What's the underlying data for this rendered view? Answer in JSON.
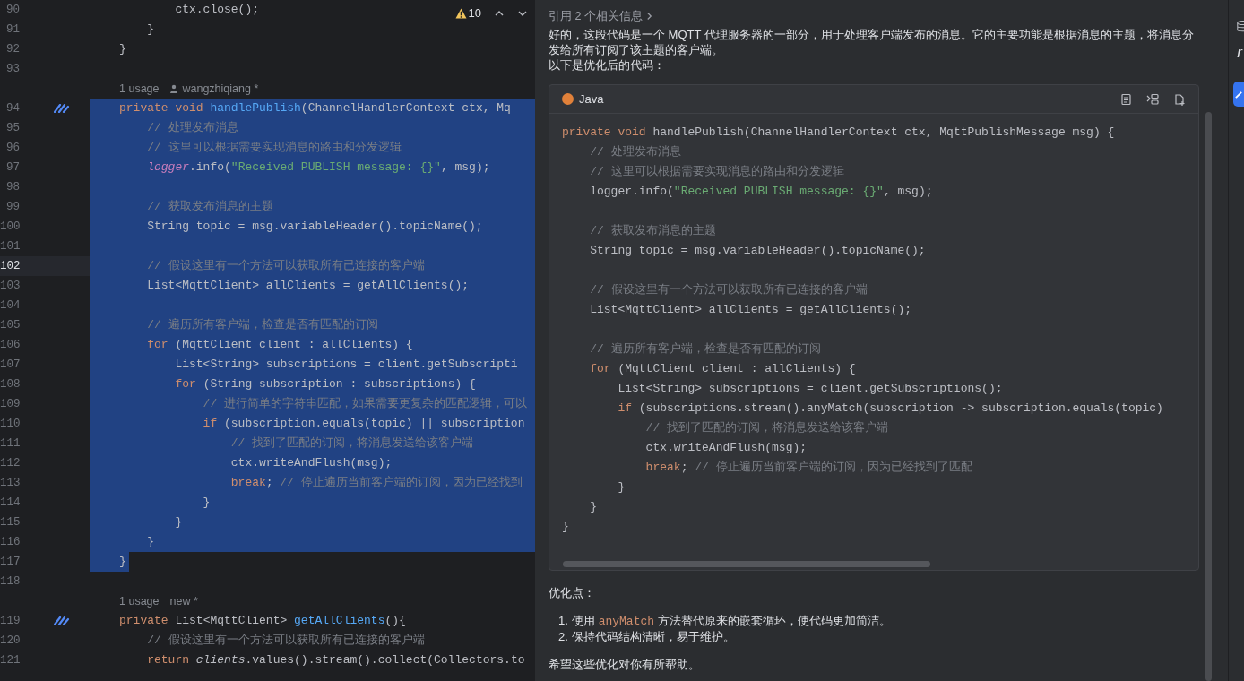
{
  "editor": {
    "inspection": {
      "warnings": "10"
    },
    "lines": [
      {
        "kind": "code",
        "number": "90",
        "selected": false,
        "current": false,
        "gutter_mark": false,
        "tokens": [
          {
            "kind": "plain",
            "text": "        ctx.close();"
          }
        ]
      },
      {
        "kind": "code",
        "number": "91",
        "selected": false,
        "current": false,
        "gutter_mark": false,
        "tokens": [
          {
            "kind": "plain",
            "text": "    }"
          }
        ]
      },
      {
        "kind": "code",
        "number": "92",
        "selected": false,
        "current": false,
        "gutter_mark": false,
        "tokens": [
          {
            "kind": "plain",
            "text": "}"
          }
        ]
      },
      {
        "kind": "blank",
        "number": "93",
        "selected": false,
        "current": false,
        "gutter_mark": false
      },
      {
        "kind": "annotation",
        "usage": "1 usage",
        "author": "wangzhiqiang *",
        "person_icon": true
      },
      {
        "kind": "code",
        "number": "94",
        "selected": true,
        "current": false,
        "gutter_mark": true,
        "tokens": [
          {
            "kind": "kw",
            "text": "private void "
          },
          {
            "kind": "fn",
            "text": "handlePublish"
          },
          {
            "kind": "plain",
            "text": "(ChannelHandlerContext ctx, Mq"
          }
        ]
      },
      {
        "kind": "code",
        "number": "95",
        "selected": true,
        "current": false,
        "gutter_mark": false,
        "tokens": [
          {
            "kind": "cmt",
            "text": "    // 处理发布消息"
          }
        ]
      },
      {
        "kind": "code",
        "number": "96",
        "selected": true,
        "current": false,
        "gutter_mark": false,
        "tokens": [
          {
            "kind": "cmt",
            "text": "    // 这里可以根据需要实现消息的路由和分发逻辑"
          }
        ]
      },
      {
        "kind": "code",
        "number": "97",
        "selected": true,
        "current": false,
        "gutter_mark": false,
        "tokens": [
          {
            "kind": "field",
            "text": "    logger"
          },
          {
            "kind": "plain",
            "text": ".info("
          },
          {
            "kind": "str",
            "text": "\"Received PUBLISH message: {}\""
          },
          {
            "kind": "plain",
            "text": ", msg);"
          }
        ]
      },
      {
        "kind": "blank",
        "number": "98",
        "selected": true,
        "current": false,
        "gutter_mark": false
      },
      {
        "kind": "code",
        "number": "99",
        "selected": true,
        "current": false,
        "gutter_mark": false,
        "tokens": [
          {
            "kind": "cmt",
            "text": "    // 获取发布消息的主题"
          }
        ]
      },
      {
        "kind": "code",
        "number": "100",
        "selected": true,
        "current": false,
        "gutter_mark": false,
        "tokens": [
          {
            "kind": "plain",
            "text": "    String topic = msg.variableHeader().topicName();"
          }
        ]
      },
      {
        "kind": "blank",
        "number": "101",
        "selected": true,
        "current": false,
        "gutter_mark": false
      },
      {
        "kind": "code",
        "number": "102",
        "selected": true,
        "current": true,
        "gutter_mark": false,
        "tokens": [
          {
            "kind": "cmt",
            "text": "    // 假设这里有一个方法可以获取所有已连接的客户端"
          }
        ]
      },
      {
        "kind": "code",
        "number": "103",
        "selected": true,
        "current": false,
        "gutter_mark": false,
        "tokens": [
          {
            "kind": "plain",
            "text": "    List<MqttClient> allClients = getAllClients();"
          }
        ]
      },
      {
        "kind": "blank",
        "number": "104",
        "selected": true,
        "current": false,
        "gutter_mark": false
      },
      {
        "kind": "code",
        "number": "105",
        "selected": true,
        "current": false,
        "gutter_mark": false,
        "tokens": [
          {
            "kind": "cmt",
            "text": "    // 遍历所有客户端，检查是否有匹配的订阅"
          }
        ]
      },
      {
        "kind": "code",
        "number": "106",
        "selected": true,
        "current": false,
        "gutter_mark": false,
        "tokens": [
          {
            "kind": "kw",
            "text": "    for"
          },
          {
            "kind": "plain",
            "text": " (MqttClient client : allClients) {"
          }
        ]
      },
      {
        "kind": "code",
        "number": "107",
        "selected": true,
        "current": false,
        "gutter_mark": false,
        "tokens": [
          {
            "kind": "plain",
            "text": "        List<String> subscriptions = client.getSubscripti"
          }
        ]
      },
      {
        "kind": "code",
        "number": "108",
        "selected": true,
        "current": false,
        "gutter_mark": false,
        "tokens": [
          {
            "kind": "kw",
            "text": "        for"
          },
          {
            "kind": "plain",
            "text": " (String subscription : subscriptions) {"
          }
        ]
      },
      {
        "kind": "code",
        "number": "109",
        "selected": true,
        "current": false,
        "gutter_mark": false,
        "tokens": [
          {
            "kind": "cmt",
            "text": "            // 进行简单的字符串匹配，如果需要更复杂的匹配逻辑，可以"
          }
        ]
      },
      {
        "kind": "code",
        "number": "110",
        "selected": true,
        "current": false,
        "gutter_mark": false,
        "tokens": [
          {
            "kind": "kw",
            "text": "            if"
          },
          {
            "kind": "plain",
            "text": " (subscription.equals(topic) || subscription"
          }
        ]
      },
      {
        "kind": "code",
        "number": "111",
        "selected": true,
        "current": false,
        "gutter_mark": false,
        "tokens": [
          {
            "kind": "cmt",
            "text": "                // 找到了匹配的订阅，将消息发送给该客户端"
          }
        ]
      },
      {
        "kind": "code",
        "number": "112",
        "selected": true,
        "current": false,
        "gutter_mark": false,
        "tokens": [
          {
            "kind": "plain",
            "text": "                ctx.writeAndFlush(msg);"
          }
        ]
      },
      {
        "kind": "code",
        "number": "113",
        "selected": true,
        "current": false,
        "gutter_mark": false,
        "tokens": [
          {
            "kind": "kw",
            "text": "                break"
          },
          {
            "kind": "plain",
            "text": ";"
          },
          {
            "kind": "cmt",
            "text": " // 停止遍历当前客户端的订阅，因为已经找到"
          }
        ]
      },
      {
        "kind": "code",
        "number": "114",
        "selected": true,
        "current": false,
        "gutter_mark": false,
        "tokens": [
          {
            "kind": "plain",
            "text": "            }"
          }
        ]
      },
      {
        "kind": "code",
        "number": "115",
        "selected": true,
        "current": false,
        "gutter_mark": false,
        "tokens": [
          {
            "kind": "plain",
            "text": "        }"
          }
        ]
      },
      {
        "kind": "code",
        "number": "116",
        "selected": true,
        "current": false,
        "gutter_mark": false,
        "tokens": [
          {
            "kind": "plain",
            "text": "    }"
          }
        ]
      },
      {
        "kind": "code",
        "number": "117",
        "selected": true,
        "current": false,
        "gutter_mark": false,
        "tokens": [
          {
            "kind": "plain",
            "text": "}"
          }
        ]
      },
      {
        "kind": "blank",
        "number": "118",
        "selected": false,
        "current": false,
        "gutter_mark": false
      },
      {
        "kind": "annotation",
        "usage": "1 usage",
        "author": "new *",
        "person_icon": false
      },
      {
        "kind": "code",
        "number": "119",
        "selected": false,
        "current": false,
        "gutter_mark": true,
        "tokens": [
          {
            "kind": "kw",
            "text": "private "
          },
          {
            "kind": "plain",
            "text": "List<MqttClient> "
          },
          {
            "kind": "fn",
            "text": "getAllClients"
          },
          {
            "kind": "plain",
            "text": "(){"
          }
        ]
      },
      {
        "kind": "code",
        "number": "120",
        "selected": false,
        "current": false,
        "gutter_mark": false,
        "tokens": [
          {
            "kind": "cmt",
            "text": "    // 假设这里有一个方法可以获取所有已连接的客户端"
          }
        ]
      },
      {
        "kind": "code",
        "number": "121",
        "selected": false,
        "current": false,
        "gutter_mark": false,
        "tokens": [
          {
            "kind": "kw",
            "text": "    return "
          },
          {
            "kind": "static",
            "text": "clients"
          },
          {
            "kind": "plain",
            "text": ".values().stream().collect(Collectors.to"
          }
        ]
      }
    ]
  },
  "chat": {
    "references": "引用 2 个相关信息",
    "intro": "好的，这段代码是一个 MQTT 代理服务器的一部分，用于处理客户端发布的消息。它的主要功能是根据消息的主题，将消息分发给所有订阅了该主题的客户端。",
    "lead": "以下是优化后的代码：",
    "code_block": {
      "language": "Java",
      "lines": [
        {
          "kind": "code",
          "tokens": [
            {
              "kind": "kw",
              "text": "private void "
            },
            {
              "kind": "plain",
              "text": "handlePublish(ChannelHandlerContext ctx, MqttPublishMessage msg) {"
            }
          ]
        },
        {
          "kind": "code",
          "tokens": [
            {
              "kind": "cmt",
              "text": "    // 处理发布消息"
            }
          ]
        },
        {
          "kind": "code",
          "tokens": [
            {
              "kind": "cmt",
              "text": "    // 这里可以根据需要实现消息的路由和分发逻辑"
            }
          ]
        },
        {
          "kind": "code",
          "tokens": [
            {
              "kind": "plain",
              "text": "    logger.info("
            },
            {
              "kind": "str",
              "text": "\"Received PUBLISH message: {}\""
            },
            {
              "kind": "plain",
              "text": ", msg);"
            }
          ]
        },
        {
          "kind": "blank"
        },
        {
          "kind": "code",
          "tokens": [
            {
              "kind": "cmt",
              "text": "    // 获取发布消息的主题"
            }
          ]
        },
        {
          "kind": "code",
          "tokens": [
            {
              "kind": "plain",
              "text": "    String topic = msg.variableHeader().topicName();"
            }
          ]
        },
        {
          "kind": "blank"
        },
        {
          "kind": "code",
          "tokens": [
            {
              "kind": "cmt",
              "text": "    // 假设这里有一个方法可以获取所有已连接的客户端"
            }
          ]
        },
        {
          "kind": "code",
          "tokens": [
            {
              "kind": "plain",
              "text": "    List<MqttClient> allClients = getAllClients();"
            }
          ]
        },
        {
          "kind": "blank"
        },
        {
          "kind": "code",
          "tokens": [
            {
              "kind": "cmt",
              "text": "    // 遍历所有客户端，检查是否有匹配的订阅"
            }
          ]
        },
        {
          "kind": "code",
          "tokens": [
            {
              "kind": "kw",
              "text": "    for"
            },
            {
              "kind": "plain",
              "text": " (MqttClient client : allClients) {"
            }
          ]
        },
        {
          "kind": "code",
          "tokens": [
            {
              "kind": "plain",
              "text": "        List<String> subscriptions = client.getSubscriptions();"
            }
          ]
        },
        {
          "kind": "code",
          "tokens": [
            {
              "kind": "kw",
              "text": "        if"
            },
            {
              "kind": "plain",
              "text": " (subscriptions.stream().anyMatch(subscription -> subscription.equals(topic)"
            }
          ]
        },
        {
          "kind": "code",
          "tokens": [
            {
              "kind": "cmt",
              "text": "            // 找到了匹配的订阅，将消息发送给该客户端"
            }
          ]
        },
        {
          "kind": "code",
          "tokens": [
            {
              "kind": "plain",
              "text": "            ctx.writeAndFlush(msg);"
            }
          ]
        },
        {
          "kind": "code",
          "tokens": [
            {
              "kind": "kw",
              "text": "            break"
            },
            {
              "kind": "plain",
              "text": ";"
            },
            {
              "kind": "cmt",
              "text": " // 停止遍历当前客户端的订阅，因为已经找到了匹配"
            }
          ]
        },
        {
          "kind": "code",
          "tokens": [
            {
              "kind": "plain",
              "text": "        }"
            }
          ]
        },
        {
          "kind": "code",
          "tokens": [
            {
              "kind": "plain",
              "text": "    }"
            }
          ]
        },
        {
          "kind": "code",
          "tokens": [
            {
              "kind": "plain",
              "text": "}"
            }
          ]
        }
      ]
    },
    "points_title": "优化点：",
    "points": [
      {
        "marker": "1.",
        "parts": [
          {
            "kind": "text",
            "text": "使用 "
          },
          {
            "kind": "code",
            "text": "anyMatch"
          },
          {
            "kind": "text",
            "text": " 方法替代原来的嵌套循环，使代码更加简洁。"
          }
        ]
      },
      {
        "marker": "2.",
        "parts": [
          {
            "kind": "text",
            "text": "保持代码结构清晰，易于维护。"
          }
        ]
      }
    ],
    "closing": "希望这些优化对你有所帮助。"
  },
  "side_strip": {
    "label": "r"
  }
}
